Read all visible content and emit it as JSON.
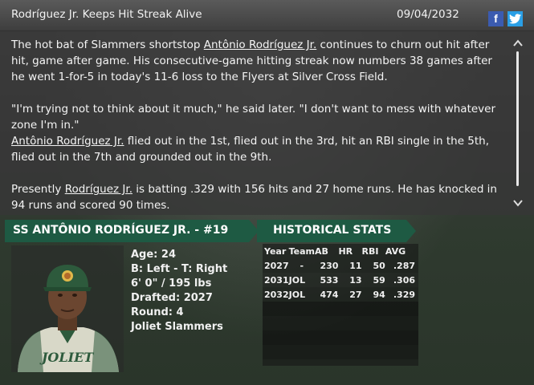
{
  "header": {
    "title": "Rodríguez Jr. Keeps Hit Streak Alive",
    "date": "09/04/2032",
    "facebook_label": "f"
  },
  "article": {
    "p1_a": "The hot bat of Slammers shortstop ",
    "p1_link": "Antônio Rodríguez Jr.",
    "p1_b": " continues to churn out hit after hit, game after game. His consecutive-game hitting streak now numbers 38 games after he went 1-for-5 in today's 11-6 loss to the Flyers at Silver Cross Field.",
    "p2": "\"I'm trying not to think about it much,\" he said later. \"I don't want to mess with whatever zone I'm in.\"",
    "p3_link": "Antônio Rodríguez Jr.",
    "p3_b": " flied out in the 1st, flied out in the 3rd, hit an RBI single in the 5th, flied out in the 7th and grounded out in the 9th.",
    "p4_a": "Presently ",
    "p4_link": "Rodríguez Jr.",
    "p4_b": " is batting .329 with 156 hits and 27 home runs. He has knocked in 94 runs and scored 90 times."
  },
  "player": {
    "banner": "SS ANTÔNIO RODRÍGUEZ JR. - #19",
    "age": "Age: 24",
    "bats_throws": "B: Left - T: Right",
    "height_weight": "6' 0\" / 195 lbs",
    "drafted": "Drafted: 2027",
    "round": "Round: 4",
    "team": "Joliet Slammers",
    "jersey_text": "JOLIET"
  },
  "historical": {
    "banner": "HISTORICAL STATS",
    "headers": [
      "Year",
      "Team",
      "AB",
      "HR",
      "RBI",
      "AVG"
    ],
    "rows": [
      [
        "2027",
        "-",
        "230",
        "11",
        "50",
        ".287"
      ],
      [
        "2031",
        "JOL",
        "533",
        "13",
        "59",
        ".306"
      ],
      [
        "2032",
        "JOL",
        "474",
        "27",
        "94",
        ".329"
      ]
    ]
  },
  "colors": {
    "banner_green": "#1e5a43",
    "facebook_blue": "#3b5bb0",
    "twitter_blue": "#2a9fe6"
  }
}
